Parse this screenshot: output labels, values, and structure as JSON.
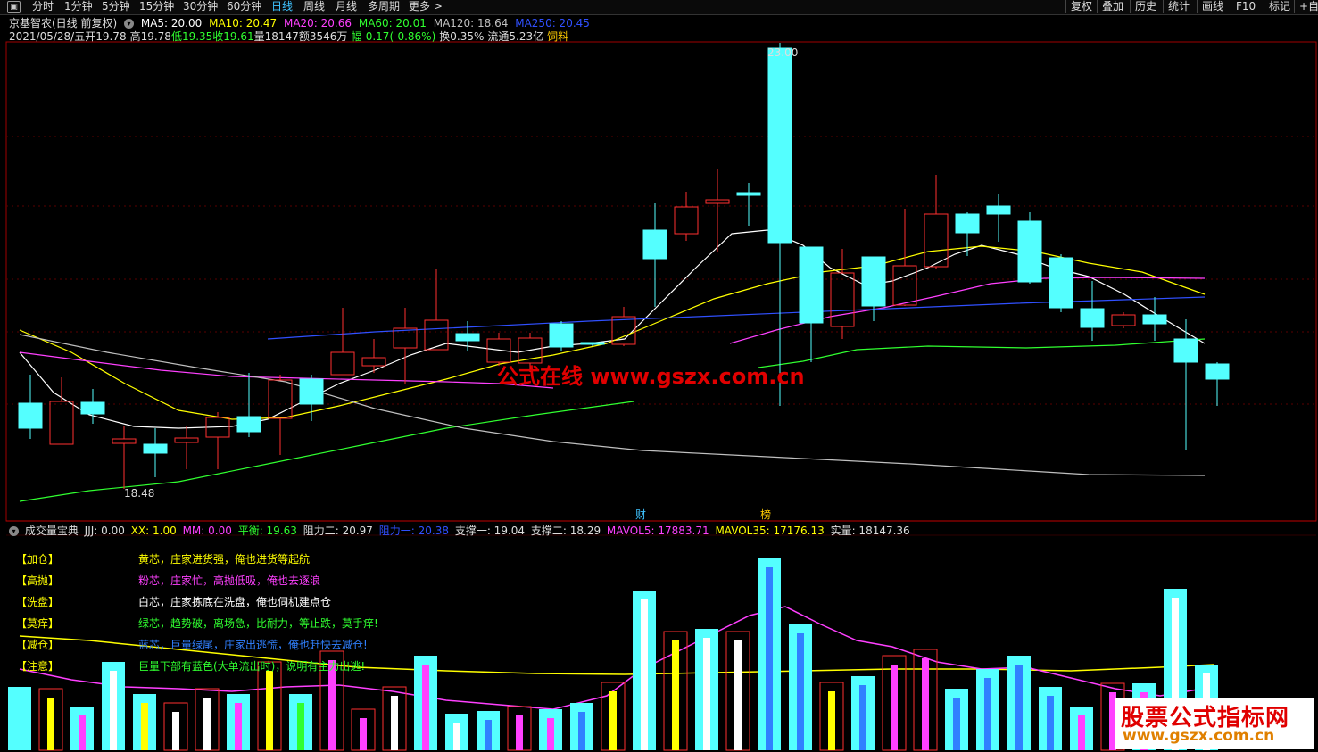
{
  "toolbar": {
    "lock_icon": "lock-icon",
    "periods": [
      "分时",
      "1分钟",
      "5分钟",
      "15分钟",
      "30分钟",
      "60分钟",
      "日线",
      "周线",
      "月线",
      "多周期",
      "更多 >"
    ],
    "active_period": "日线",
    "tools": [
      "复权",
      "叠加",
      "历史",
      "统计",
      "画线",
      "F10",
      "标记",
      "+自"
    ]
  },
  "stock_info": {
    "name": "京基智农(日线 前复权)",
    "ma5": "MA5: 20.00",
    "ma10": "MA10: 20.47",
    "ma20": "MA20: 20.66",
    "ma60": "MA60: 20.01",
    "ma120": "MA120: 18.64",
    "ma250": "MA250: 20.45",
    "date": "2021/05/28/五",
    "open": "开19.78",
    "high": "高19.78",
    "low": "低19.35",
    "close": "收19.61",
    "volume": "量18147",
    "amount": "额3546万",
    "change": "幅-0.17(-0.86%)",
    "turnover": "换0.35%",
    "float_cap": "流通5.23亿",
    "material": "饲料"
  },
  "price_chart": {
    "high_label": "23.00",
    "low_label": "18.48",
    "marker_finance": "财",
    "marker_list": "榜",
    "watermark": "公式在线  www.gszx.com.cn"
  },
  "indicator": {
    "title": "成交量宝典",
    "jjj": "JJJ: 0.00",
    "xx": "XX: 1.00",
    "mm": "MM: 0.00",
    "balance": "平衡: 19.63",
    "resist2": "阻力二: 20.97",
    "resist1": "阻力一: 20.38",
    "support1": "支撑一: 19.04",
    "support2": "支撑二: 18.29",
    "mavol5": "MAVOL5: 17883.71",
    "mavol35": "MAVOL35: 17176.13",
    "real_vol": "实量: 18147.36",
    "legend": [
      {
        "tag": "【加仓】",
        "text": "黄芯，庄家进货强，俺也进货等起航",
        "color": "#ffff00"
      },
      {
        "tag": "【高抛】",
        "text": "粉芯，庄家忙，高抛低吸，俺也去逐浪",
        "color": "#ff40ff"
      },
      {
        "tag": "【洗盘】",
        "text": "白芯，庄家拣底在洗盘，俺也伺机建点仓",
        "color": "#ffffff"
      },
      {
        "tag": "【莫痒】",
        "text": "绿芯，趋势破，离场急，比耐力，等止跌，莫手痒!",
        "color": "#30ff30"
      },
      {
        "tag": "【减仓】",
        "text": "蓝芯，巨量绿尾，庄家出逃慌，俺也赶快去减仓!",
        "color": "#3080ff"
      },
      {
        "tag": "【注意】",
        "text": "巨量下部有蓝色(大单流出时)，说明有主力出逃!",
        "color": "#3080ff"
      }
    ]
  },
  "logo": {
    "title": "股票公式指标网",
    "url": "www.gszx.com.cn"
  },
  "colors": {
    "up": "#ff3030",
    "down": "#54ffff",
    "ma5": "#ffffff",
    "ma10": "#ffff00",
    "ma20": "#ff40ff",
    "ma60": "#30ff30",
    "ma120": "#c0c0c0",
    "ma250": "#3050ff"
  }
}
